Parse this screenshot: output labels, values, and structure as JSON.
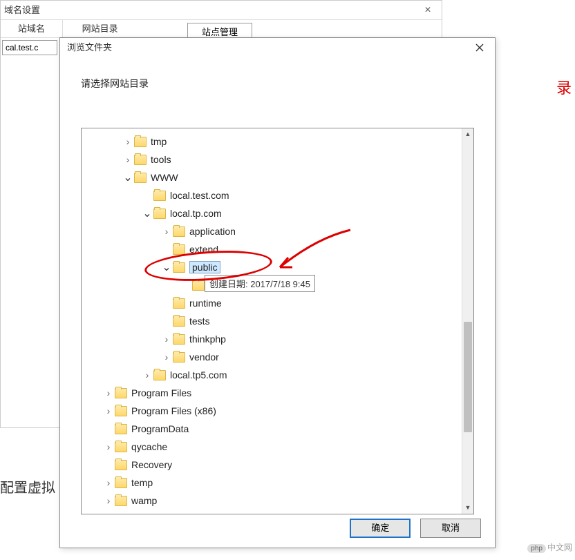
{
  "bg": {
    "title": "域名设置",
    "h1": "站域名",
    "h2": "网站目录",
    "tab": "站点管理",
    "input_value": "cal.test.c",
    "bottom_text": "配置虚拟"
  },
  "red_char": "录",
  "dialog": {
    "title": "浏览文件夹",
    "prompt": "请选择网站目录",
    "ok": "确定",
    "cancel": "取消"
  },
  "tree": [
    {
      "level": 0,
      "chev": ">",
      "label": "tmp"
    },
    {
      "level": 0,
      "chev": ">",
      "label": "tools"
    },
    {
      "level": 0,
      "chev": "v",
      "label": "WWW"
    },
    {
      "level": 1,
      "chev": "",
      "label": "local.test.com"
    },
    {
      "level": 1,
      "chev": "v",
      "label": "local.tp.com"
    },
    {
      "level": 2,
      "chev": ">",
      "label": "application"
    },
    {
      "level": 2,
      "chev": "",
      "label": "extend"
    },
    {
      "level": 2,
      "chev": "v",
      "label": "public",
      "selected": true
    },
    {
      "level": 3,
      "chev": "",
      "label": ""
    },
    {
      "level": 2,
      "chev": "",
      "label": "runtime"
    },
    {
      "level": 2,
      "chev": "",
      "label": "tests"
    },
    {
      "level": 2,
      "chev": ">",
      "label": "thinkphp"
    },
    {
      "level": 2,
      "chev": ">",
      "label": "vendor"
    },
    {
      "level": 1,
      "chev": ">",
      "label": "local.tp5.com"
    },
    {
      "level": -1,
      "chev": ">",
      "label": "Program Files"
    },
    {
      "level": -1,
      "chev": ">",
      "label": "Program Files (x86)"
    },
    {
      "level": -1,
      "chev": "",
      "label": "ProgramData"
    },
    {
      "level": -1,
      "chev": ">",
      "label": "qycache"
    },
    {
      "level": -1,
      "chev": "",
      "label": "Recovery"
    },
    {
      "level": -1,
      "chev": ">",
      "label": "temp"
    },
    {
      "level": -1,
      "chev": ">",
      "label": "wamp"
    }
  ],
  "tooltip": "创建日期: 2017/7/18 9:45",
  "watermark": {
    "badge": "php",
    "text": "中文网"
  }
}
